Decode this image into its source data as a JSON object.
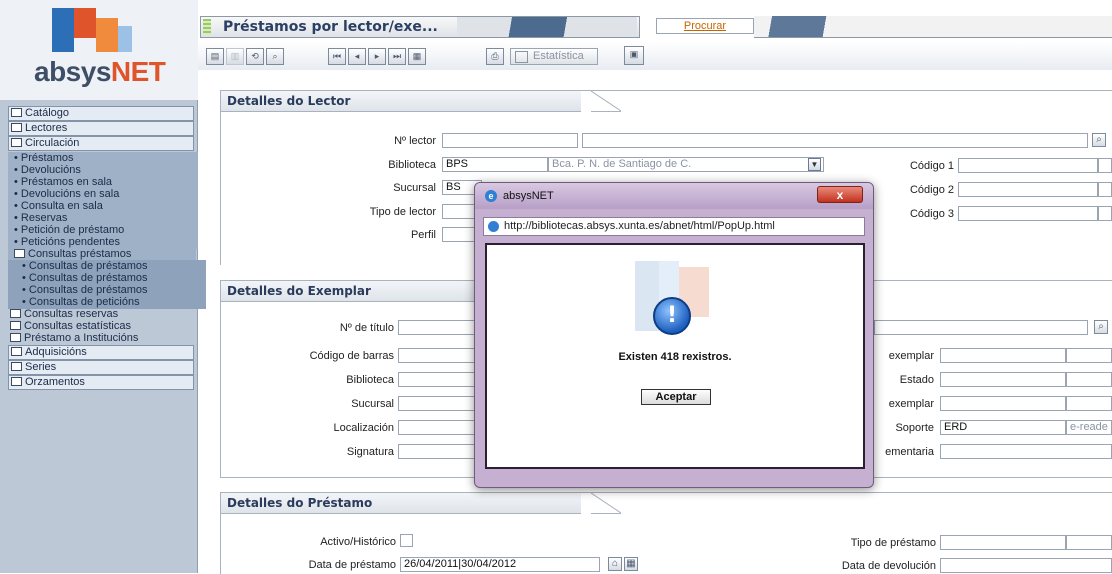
{
  "app": {
    "logo_prefix": "absys",
    "logo_suffix": "NET"
  },
  "sidebar": {
    "items": [
      {
        "label": "Catálogo"
      },
      {
        "label": "Lectores"
      },
      {
        "label": "Circulación"
      },
      {
        "label": "• Préstamos"
      },
      {
        "label": "• Devolucións"
      },
      {
        "label": "• Préstamos en sala"
      },
      {
        "label": "• Devolucións en sala"
      },
      {
        "label": "• Consulta en sala"
      },
      {
        "label": "• Reservas"
      },
      {
        "label": "• Petición de préstamo"
      },
      {
        "label": "• Peticións pendentes"
      },
      {
        "label": "Consultas préstamos"
      },
      {
        "label": "• Consultas de préstamos"
      },
      {
        "label": "• Consultas de préstamos"
      },
      {
        "label": "• Consultas de préstamos"
      },
      {
        "label": "• Consultas de peticións"
      },
      {
        "label": "Consultas reservas"
      },
      {
        "label": "Consultas estatísticas"
      },
      {
        "label": "Préstamo a Institucións"
      },
      {
        "label": "Adquisicións"
      },
      {
        "label": "Series"
      },
      {
        "label": "Orzamentos"
      }
    ]
  },
  "header": {
    "title": "Préstamos por lector/exe...",
    "search_label": "Procurar"
  },
  "toolbar": {
    "stat_label": "Estatística"
  },
  "lector": {
    "section_title": "Detalles do Lector",
    "n_lector_label": "Nº lector",
    "biblioteca_label": "Biblioteca",
    "biblioteca_code": "BPS",
    "biblioteca_name": "Bca. P. N. de Santiago de C.",
    "sucursal_label": "Sucursal",
    "sucursal_code": "BS",
    "tipo_label": "Tipo de lector",
    "perfil_label": "Perfil",
    "codigo1_label": "Código 1",
    "codigo2_label": "Código 2",
    "codigo3_label": "Código 3"
  },
  "exemplar": {
    "section_title": "Detalles do Exemplar",
    "titulo_label": "Nº de título",
    "barras_label": "Código de barras",
    "biblioteca_label": "Biblioteca",
    "sucursal_label": "Sucursal",
    "localizacion_label": "Localización",
    "signatura_label": "Signatura",
    "r_exemplar1_label": "exemplar",
    "estado_label": "Estado",
    "r_exemplar2_label": "exemplar",
    "soporte_label": "Soporte",
    "soporte_value": "ERD",
    "soporte_desc": "e-reade",
    "complementaria_label": "ementaria"
  },
  "prestamo": {
    "section_title": "Detalles do Préstamo",
    "activo_label": "Activo/Histórico",
    "data_label": "Data de préstamo",
    "data_value": "26/04/2011|30/04/2012",
    "tipo_label": "Tipo de préstamo",
    "devolucion_label": "Data de devolución"
  },
  "popup": {
    "title": "absysNET",
    "url": "http://bibliotecas.absys.xunta.es/abnet/html/PopUp.html",
    "close_label": "x",
    "message": "Existen 418 rexistros.",
    "ok_label": "Aceptar"
  },
  "colors": {
    "accent_orange": "#e0542b",
    "sidebar_bg": "#bcc8d6",
    "popup_frame": "#c6b0d2"
  }
}
